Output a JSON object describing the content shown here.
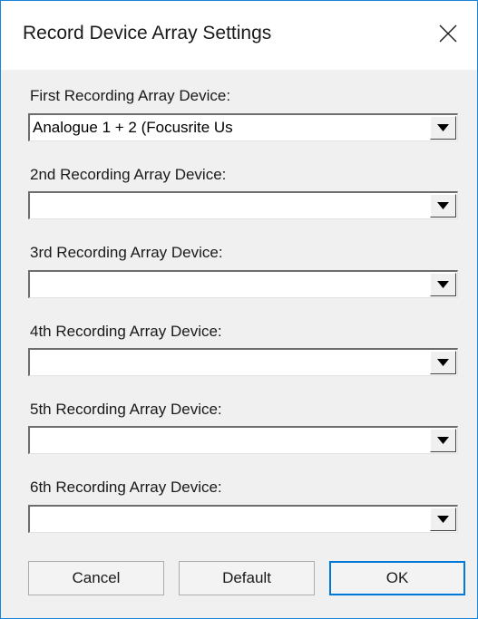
{
  "window": {
    "title": "Record Device Array Settings",
    "close_icon": "close-icon"
  },
  "devices": [
    {
      "label": "First Recording Array Device:",
      "value": "Analogue 1 + 2 (Focusrite Us"
    },
    {
      "label": "2nd Recording Array Device:",
      "value": ""
    },
    {
      "label": "3rd Recording Array Device:",
      "value": ""
    },
    {
      "label": "4th Recording Array Device:",
      "value": ""
    },
    {
      "label": "5th Recording Array Device:",
      "value": ""
    },
    {
      "label": "6th Recording Array Device:",
      "value": ""
    }
  ],
  "buttons": {
    "cancel": "Cancel",
    "default": "Default",
    "ok": "OK"
  },
  "colors": {
    "accent": "#0078d7",
    "window_border": "#1883d7",
    "dialog_bg": "#f0f0f0"
  }
}
